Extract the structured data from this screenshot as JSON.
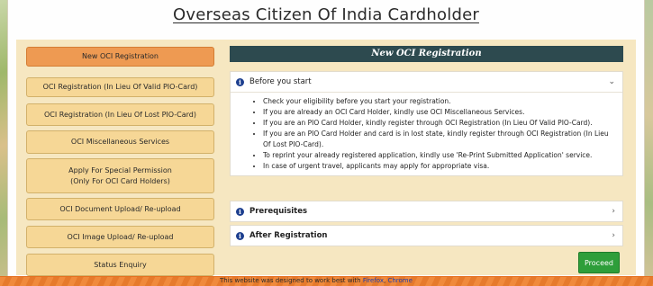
{
  "header": {
    "title": "Overseas Citizen Of India Cardholder"
  },
  "sidebar": {
    "items": [
      {
        "label": "New OCI Registration"
      },
      {
        "label": "OCI Registration (In Lieu Of Valid PIO-Card)"
      },
      {
        "label": "OCI Registration (In Lieu Of Lost PIO-Card)"
      },
      {
        "label": "OCI Miscellaneous Services"
      },
      {
        "label": "Apply For Special Permission\n(Only For OCI Card Holders)"
      },
      {
        "label": "OCI Document Upload/ Re-upload"
      },
      {
        "label": "OCI Image Upload/ Re-upload"
      },
      {
        "label": "Status Enquiry"
      }
    ]
  },
  "main": {
    "heading": "New OCI Registration",
    "sections": [
      {
        "title": "Before you start",
        "expanded": true,
        "items": [
          "Check your eligibility before you start your registration.",
          "If you are already an OCI Card Holder, kindly use OCI Miscellaneous Services.",
          "If you are an PIO Card Holder, kindly register through OCI Registration (In Lieu Of Valid PIO-Card).",
          "If you are an PIO Card Holder and card is in lost state, kindly register through OCI Registration (In Lieu Of Lost PIO-Card).",
          "To reprint your already registered application, kindly use 'Re-Print Submitted Application' service.",
          "In case of urgent travel, applicants may apply for appropriate visa."
        ]
      },
      {
        "title": "Prerequisites",
        "expanded": false
      },
      {
        "title": "After Registration",
        "expanded": false
      }
    ],
    "proceed_label": "Proceed"
  },
  "footer": {
    "text": "This website was designed to work best with",
    "links": [
      "Firefox",
      "Chrome"
    ]
  },
  "colors": {
    "accent_active": "#ee9a52",
    "sidebar_button": "#f6d796",
    "panel_header": "#2d4a4f",
    "proceed": "#2e9e3a",
    "footer": "#f08a3c"
  },
  "icons": {
    "info": "info-icon",
    "chevron_down": "chevron-down-icon",
    "chevron_right": "chevron-right-icon"
  }
}
